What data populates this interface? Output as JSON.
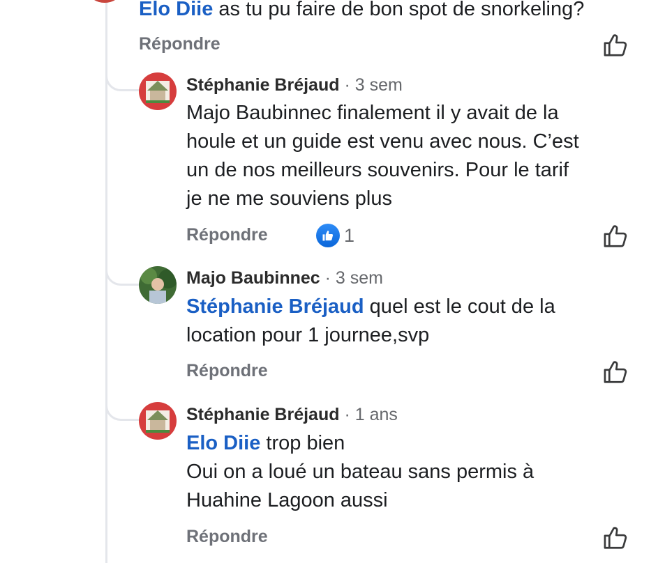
{
  "top_comment": {
    "mention": "Elo Diie",
    "text": " as tu pu faire de bon spot de snorkeling?",
    "reply_label": "Répondre"
  },
  "replies": [
    {
      "author": "Stéphanie Bréjaud",
      "time": " · 3 sem",
      "lines": [
        "Majo Baubinnec finalement il y avait de la",
        "houle et un guide est venu avec nous. C’est",
        "un de nos meilleurs souvenirs. Pour le tarif",
        "je ne me souviens plus"
      ],
      "reply_label": "Répondre",
      "reaction_count": "1"
    },
    {
      "author": "Majo Baubinnec",
      "time": " · 3 sem",
      "mention": "Stéphanie Bréjaud",
      "line1_text": " quel est le cout de la",
      "line2": "location pour 1 journee,svp",
      "reply_label": "Répondre"
    },
    {
      "author": "Stéphanie Bréjaud",
      "time": " · 1 ans",
      "mention": "Elo Diie",
      "line1_text": " trop bien",
      "line2": "Oui on a loué un bateau sans permis à",
      "line3": "Huahine Lagoon aussi",
      "reply_label": "Répondre"
    }
  ],
  "colors": {
    "mention": "#1a5fc4",
    "secondary_text": "#65676b",
    "thread_line": "#e4e6eb",
    "like_badge": "#1877f2"
  },
  "icons": {
    "like": "thumbs-up-outline-icon",
    "reaction": "like-reaction-icon"
  }
}
